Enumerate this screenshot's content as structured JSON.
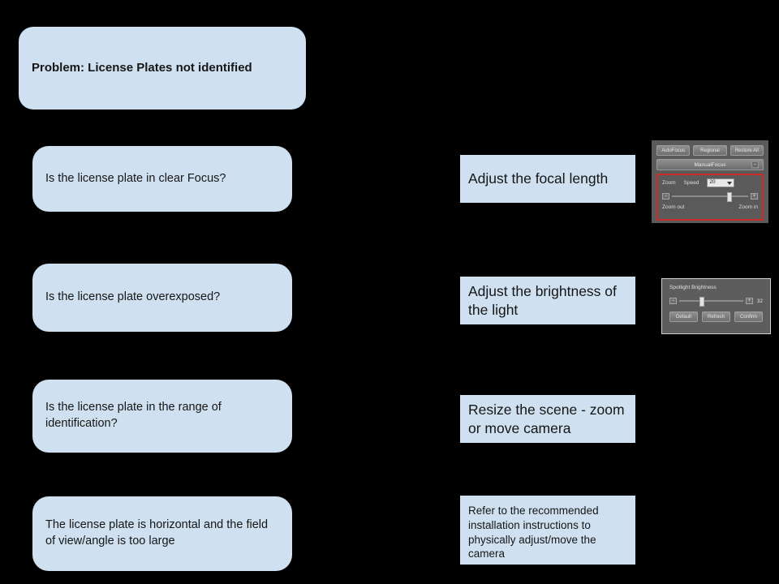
{
  "diagram": {
    "title_node": {
      "label": "Problem: License Plates not identified"
    },
    "questions": [
      {
        "label": "Is the license plate in clear Focus?"
      },
      {
        "label": "Is the license plate overexposed?"
      },
      {
        "label": "Is the license plate in the range of identification?"
      },
      {
        "label": "The license plate is horizontal and the field of view/angle is too large"
      }
    ],
    "actions": [
      {
        "label": "Adjust the focal length"
      },
      {
        "label": "Adjust the brightness of the light"
      },
      {
        "label": "Resize the scene - zoom or move camera"
      },
      {
        "label": "Refer to the recommended installation instructions to physically adjust/move the camera"
      }
    ]
  },
  "focus_panel": {
    "buttons": [
      {
        "label": "AutoFocus"
      },
      {
        "label": "Regional"
      },
      {
        "label": "Restore All"
      }
    ],
    "manual_focus": {
      "label": "ManualFocus",
      "collapse_icon": "−"
    },
    "zoom_group": {
      "zoom_label": "Zoom",
      "speed_label": "Speed",
      "speed_value": "20",
      "minus_icon": "−",
      "plus_icon": "+",
      "zoom_out_label": "Zoom out",
      "zoom_in_label": "Zoom in",
      "slider_percent": 72,
      "highlight_color": "#cc2b2b"
    }
  },
  "brightness_panel": {
    "title": "Spotlight Brightness",
    "value": "32",
    "minus_icon": "−",
    "plus_icon": "+",
    "slider_percent": 32,
    "buttons": [
      {
        "label": "Default"
      },
      {
        "label": "Refresh"
      },
      {
        "label": "Confirm"
      }
    ]
  },
  "colors": {
    "background": "#000000",
    "node_fill": "#cfe0f0",
    "node_text": "#161616",
    "panel_bg": "#5a5a5a",
    "highlight": "#cc2b2b"
  }
}
